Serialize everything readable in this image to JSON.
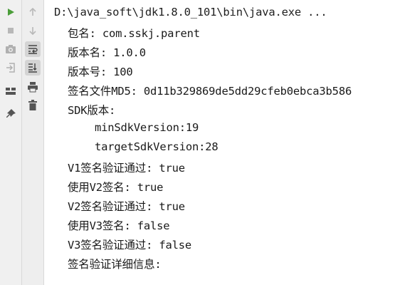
{
  "console": {
    "command": "D:\\java_soft\\jdk1.8.0_101\\bin\\java.exe ...",
    "lines": [
      "包名: com.sskj.parent",
      "版本名: 1.0.0",
      "版本号: 100",
      "签名文件MD5: 0d11b329869de5dd29cfeb0ebca3b586",
      "SDK版本:",
      "minSdkVersion:19",
      "targetSdkVersion:28",
      "V1签名验证通过: true",
      "使用V2签名: true",
      "V2签名验证通过: true",
      "使用V3签名: false",
      "V3签名验证通过: false",
      "签名验证详细信息:"
    ]
  },
  "toolbar": {
    "left": [
      "run-icon",
      "stop-icon",
      "camera-icon",
      "exit-icon",
      "layout-icon",
      "pin-icon"
    ],
    "right": [
      "up-arrow-icon",
      "down-arrow-icon",
      "soft-wrap-icon",
      "scroll-to-end-icon",
      "print-icon",
      "trash-icon"
    ]
  },
  "colors": {
    "run_green": "#4b9e3a",
    "console_bg": "#ffffff",
    "toolbar_bg": "#f0f0f0"
  }
}
